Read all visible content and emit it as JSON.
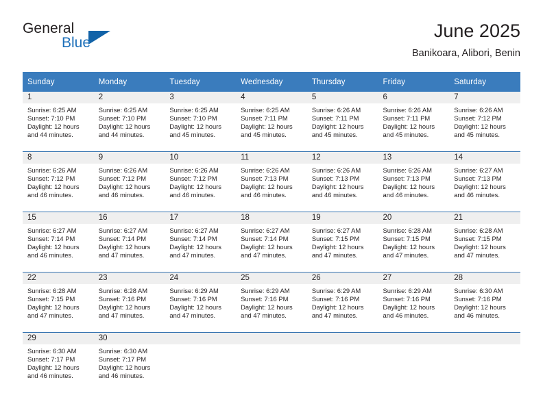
{
  "brand": {
    "name_part1": "General",
    "name_part2": "Blue",
    "logo_icon": "triangle-logo-icon"
  },
  "header": {
    "title": "June 2025",
    "subtitle": "Banikoara, Alibori, Benin"
  },
  "colors": {
    "header_blue": "#3a7cbd",
    "separator_blue": "#2f6fae",
    "daynum_band": "#efefef",
    "brand_blue": "#1c6fb9",
    "text": "#231f20"
  },
  "weekday_headers": [
    "Sunday",
    "Monday",
    "Tuesday",
    "Wednesday",
    "Thursday",
    "Friday",
    "Saturday"
  ],
  "labels": {
    "sunrise_prefix": "Sunrise:",
    "sunset_prefix": "Sunset:",
    "daylight_prefix": "Daylight:"
  },
  "weeks": [
    [
      {
        "day": "1",
        "sunrise": "Sunrise: 6:25 AM",
        "sunset": "Sunset: 7:10 PM",
        "daylight_l1": "Daylight: 12 hours",
        "daylight_l2": "and 44 minutes."
      },
      {
        "day": "2",
        "sunrise": "Sunrise: 6:25 AM",
        "sunset": "Sunset: 7:10 PM",
        "daylight_l1": "Daylight: 12 hours",
        "daylight_l2": "and 44 minutes."
      },
      {
        "day": "3",
        "sunrise": "Sunrise: 6:25 AM",
        "sunset": "Sunset: 7:10 PM",
        "daylight_l1": "Daylight: 12 hours",
        "daylight_l2": "and 45 minutes."
      },
      {
        "day": "4",
        "sunrise": "Sunrise: 6:25 AM",
        "sunset": "Sunset: 7:11 PM",
        "daylight_l1": "Daylight: 12 hours",
        "daylight_l2": "and 45 minutes."
      },
      {
        "day": "5",
        "sunrise": "Sunrise: 6:26 AM",
        "sunset": "Sunset: 7:11 PM",
        "daylight_l1": "Daylight: 12 hours",
        "daylight_l2": "and 45 minutes."
      },
      {
        "day": "6",
        "sunrise": "Sunrise: 6:26 AM",
        "sunset": "Sunset: 7:11 PM",
        "daylight_l1": "Daylight: 12 hours",
        "daylight_l2": "and 45 minutes."
      },
      {
        "day": "7",
        "sunrise": "Sunrise: 6:26 AM",
        "sunset": "Sunset: 7:12 PM",
        "daylight_l1": "Daylight: 12 hours",
        "daylight_l2": "and 45 minutes."
      }
    ],
    [
      {
        "day": "8",
        "sunrise": "Sunrise: 6:26 AM",
        "sunset": "Sunset: 7:12 PM",
        "daylight_l1": "Daylight: 12 hours",
        "daylight_l2": "and 46 minutes."
      },
      {
        "day": "9",
        "sunrise": "Sunrise: 6:26 AM",
        "sunset": "Sunset: 7:12 PM",
        "daylight_l1": "Daylight: 12 hours",
        "daylight_l2": "and 46 minutes."
      },
      {
        "day": "10",
        "sunrise": "Sunrise: 6:26 AM",
        "sunset": "Sunset: 7:12 PM",
        "daylight_l1": "Daylight: 12 hours",
        "daylight_l2": "and 46 minutes."
      },
      {
        "day": "11",
        "sunrise": "Sunrise: 6:26 AM",
        "sunset": "Sunset: 7:13 PM",
        "daylight_l1": "Daylight: 12 hours",
        "daylight_l2": "and 46 minutes."
      },
      {
        "day": "12",
        "sunrise": "Sunrise: 6:26 AM",
        "sunset": "Sunset: 7:13 PM",
        "daylight_l1": "Daylight: 12 hours",
        "daylight_l2": "and 46 minutes."
      },
      {
        "day": "13",
        "sunrise": "Sunrise: 6:26 AM",
        "sunset": "Sunset: 7:13 PM",
        "daylight_l1": "Daylight: 12 hours",
        "daylight_l2": "and 46 minutes."
      },
      {
        "day": "14",
        "sunrise": "Sunrise: 6:27 AM",
        "sunset": "Sunset: 7:13 PM",
        "daylight_l1": "Daylight: 12 hours",
        "daylight_l2": "and 46 minutes."
      }
    ],
    [
      {
        "day": "15",
        "sunrise": "Sunrise: 6:27 AM",
        "sunset": "Sunset: 7:14 PM",
        "daylight_l1": "Daylight: 12 hours",
        "daylight_l2": "and 46 minutes."
      },
      {
        "day": "16",
        "sunrise": "Sunrise: 6:27 AM",
        "sunset": "Sunset: 7:14 PM",
        "daylight_l1": "Daylight: 12 hours",
        "daylight_l2": "and 47 minutes."
      },
      {
        "day": "17",
        "sunrise": "Sunrise: 6:27 AM",
        "sunset": "Sunset: 7:14 PM",
        "daylight_l1": "Daylight: 12 hours",
        "daylight_l2": "and 47 minutes."
      },
      {
        "day": "18",
        "sunrise": "Sunrise: 6:27 AM",
        "sunset": "Sunset: 7:14 PM",
        "daylight_l1": "Daylight: 12 hours",
        "daylight_l2": "and 47 minutes."
      },
      {
        "day": "19",
        "sunrise": "Sunrise: 6:27 AM",
        "sunset": "Sunset: 7:15 PM",
        "daylight_l1": "Daylight: 12 hours",
        "daylight_l2": "and 47 minutes."
      },
      {
        "day": "20",
        "sunrise": "Sunrise: 6:28 AM",
        "sunset": "Sunset: 7:15 PM",
        "daylight_l1": "Daylight: 12 hours",
        "daylight_l2": "and 47 minutes."
      },
      {
        "day": "21",
        "sunrise": "Sunrise: 6:28 AM",
        "sunset": "Sunset: 7:15 PM",
        "daylight_l1": "Daylight: 12 hours",
        "daylight_l2": "and 47 minutes."
      }
    ],
    [
      {
        "day": "22",
        "sunrise": "Sunrise: 6:28 AM",
        "sunset": "Sunset: 7:15 PM",
        "daylight_l1": "Daylight: 12 hours",
        "daylight_l2": "and 47 minutes."
      },
      {
        "day": "23",
        "sunrise": "Sunrise: 6:28 AM",
        "sunset": "Sunset: 7:16 PM",
        "daylight_l1": "Daylight: 12 hours",
        "daylight_l2": "and 47 minutes."
      },
      {
        "day": "24",
        "sunrise": "Sunrise: 6:29 AM",
        "sunset": "Sunset: 7:16 PM",
        "daylight_l1": "Daylight: 12 hours",
        "daylight_l2": "and 47 minutes."
      },
      {
        "day": "25",
        "sunrise": "Sunrise: 6:29 AM",
        "sunset": "Sunset: 7:16 PM",
        "daylight_l1": "Daylight: 12 hours",
        "daylight_l2": "and 47 minutes."
      },
      {
        "day": "26",
        "sunrise": "Sunrise: 6:29 AM",
        "sunset": "Sunset: 7:16 PM",
        "daylight_l1": "Daylight: 12 hours",
        "daylight_l2": "and 47 minutes."
      },
      {
        "day": "27",
        "sunrise": "Sunrise: 6:29 AM",
        "sunset": "Sunset: 7:16 PM",
        "daylight_l1": "Daylight: 12 hours",
        "daylight_l2": "and 46 minutes."
      },
      {
        "day": "28",
        "sunrise": "Sunrise: 6:30 AM",
        "sunset": "Sunset: 7:16 PM",
        "daylight_l1": "Daylight: 12 hours",
        "daylight_l2": "and 46 minutes."
      }
    ],
    [
      {
        "day": "29",
        "sunrise": "Sunrise: 6:30 AM",
        "sunset": "Sunset: 7:17 PM",
        "daylight_l1": "Daylight: 12 hours",
        "daylight_l2": "and 46 minutes."
      },
      {
        "day": "30",
        "sunrise": "Sunrise: 6:30 AM",
        "sunset": "Sunset: 7:17 PM",
        "daylight_l1": "Daylight: 12 hours",
        "daylight_l2": "and 46 minutes."
      },
      {
        "day": "",
        "sunrise": "",
        "sunset": "",
        "daylight_l1": "",
        "daylight_l2": ""
      },
      {
        "day": "",
        "sunrise": "",
        "sunset": "",
        "daylight_l1": "",
        "daylight_l2": ""
      },
      {
        "day": "",
        "sunrise": "",
        "sunset": "",
        "daylight_l1": "",
        "daylight_l2": ""
      },
      {
        "day": "",
        "sunrise": "",
        "sunset": "",
        "daylight_l1": "",
        "daylight_l2": ""
      },
      {
        "day": "",
        "sunrise": "",
        "sunset": "",
        "daylight_l1": "",
        "daylight_l2": ""
      }
    ]
  ]
}
